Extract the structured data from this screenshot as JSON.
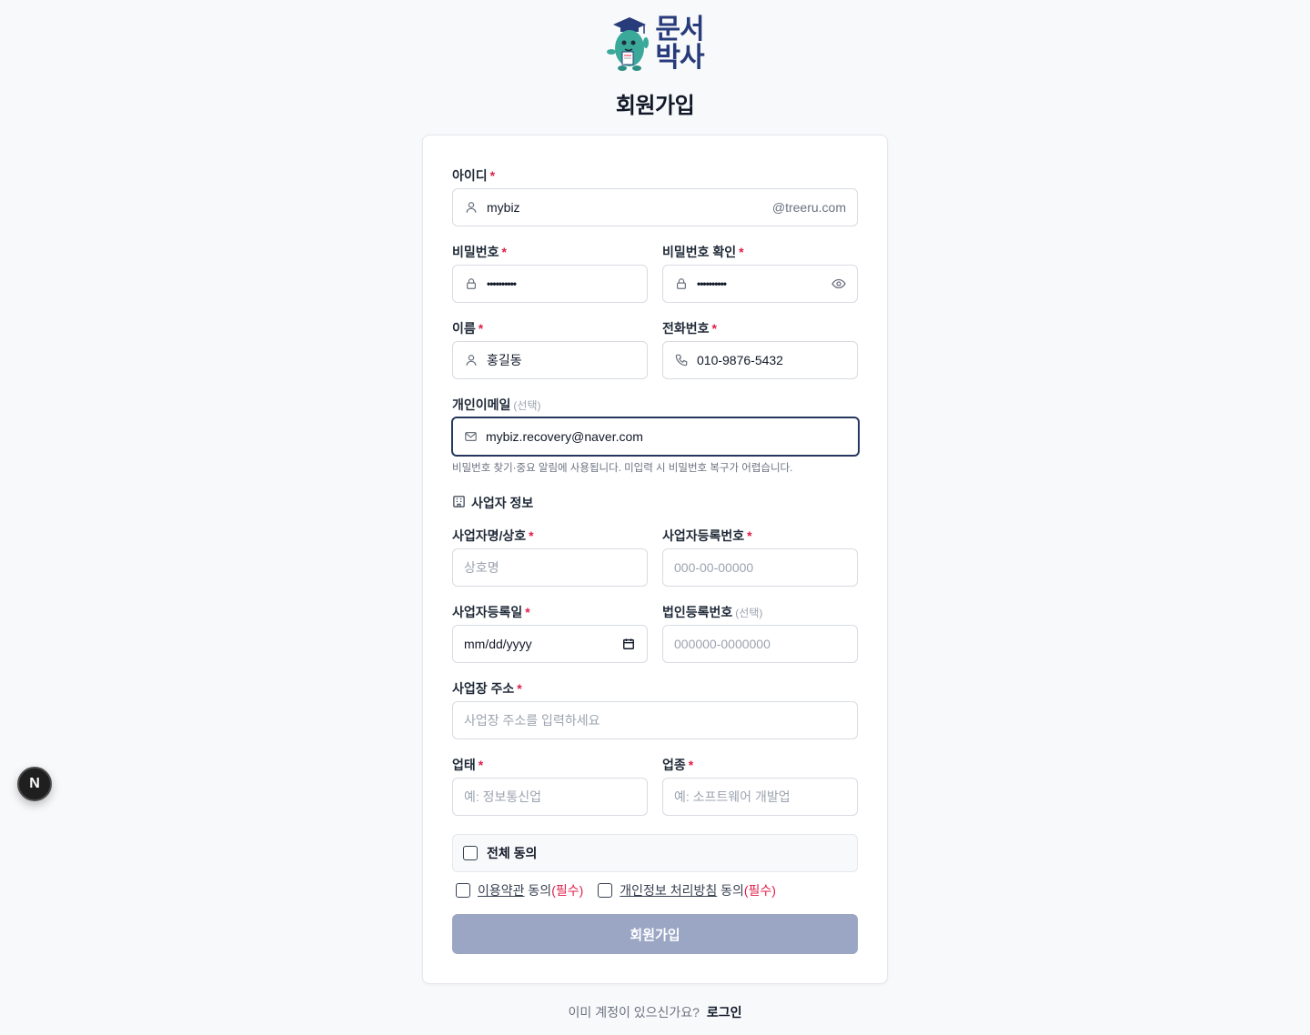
{
  "brand": {
    "line1": "문서",
    "line2": "박사"
  },
  "page_title": "회원가입",
  "form": {
    "id": {
      "label": "아이디",
      "value": "mybiz",
      "suffix": "@treeru.com",
      "icon": "user-icon"
    },
    "password": {
      "label": "비밀번호",
      "value": "••••••••••",
      "icon": "lock-icon"
    },
    "password_confirm": {
      "label": "비밀번호 확인",
      "value": "••••••••••",
      "icon": "lock-icon"
    },
    "name": {
      "label": "이름",
      "value": "홍길동",
      "icon": "user-icon"
    },
    "phone": {
      "label": "전화번호",
      "value": "010-9876-5432",
      "icon": "phone-icon"
    },
    "email": {
      "label": "개인이메일",
      "optional": "(선택)",
      "value": "mybiz.recovery@naver.com",
      "help": "비밀번호 찾기·중요 알림에 사용됩니다. 미입력 시 비밀번호 복구가 어렵습니다.",
      "icon": "mail-icon"
    },
    "business_section": "사업자 정보",
    "biz_name": {
      "label": "사업자명/상호",
      "placeholder": "상호명"
    },
    "biz_number": {
      "label": "사업자등록번호",
      "placeholder": "000-00-00000"
    },
    "biz_date": {
      "label": "사업자등록일",
      "placeholder": "mm/dd/yyyy"
    },
    "corp_number": {
      "label": "법인등록번호",
      "optional": "(선택)",
      "placeholder": "000000-0000000"
    },
    "address": {
      "label": "사업장 주소",
      "placeholder": "사업장 주소를 입력하세요"
    },
    "biz_type": {
      "label": "업태",
      "placeholder": "예: 정보통신업"
    },
    "biz_item": {
      "label": "업종",
      "placeholder": "예: 소프트웨어 개발업"
    },
    "required_mark": "*"
  },
  "agreements": {
    "all": "전체 동의",
    "terms_link": "이용약관",
    "privacy_link": "개인정보 처리방침",
    "agree_word": "동의",
    "required_tag": "(필수)"
  },
  "submit_label": "회원가입",
  "footer": {
    "question": "이미 계정이 있으신가요?",
    "login": "로그인"
  },
  "dev_badge": "N",
  "colors": {
    "brand": "#283b7a",
    "focus_border": "#25365f",
    "required": "#e11d48",
    "submit_disabled": "#9aa6c4",
    "mascot": "#3aa99a"
  }
}
